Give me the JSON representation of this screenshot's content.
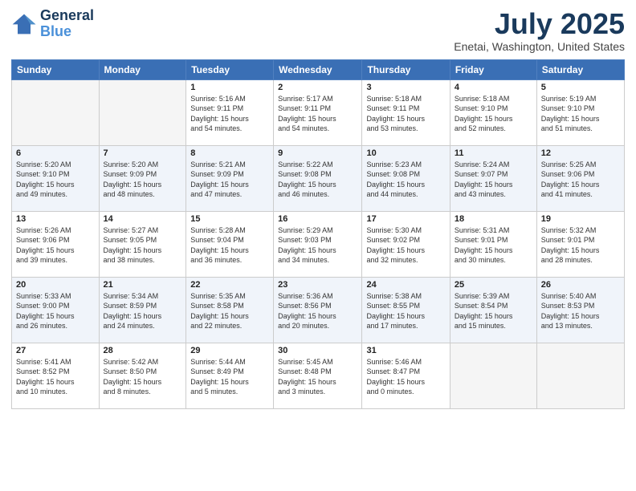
{
  "header": {
    "logo_line1": "General",
    "logo_line2": "Blue",
    "month": "July 2025",
    "location": "Enetai, Washington, United States"
  },
  "weekdays": [
    "Sunday",
    "Monday",
    "Tuesday",
    "Wednesday",
    "Thursday",
    "Friday",
    "Saturday"
  ],
  "weeks": [
    [
      {
        "day": "",
        "info": ""
      },
      {
        "day": "",
        "info": ""
      },
      {
        "day": "1",
        "info": "Sunrise: 5:16 AM\nSunset: 9:11 PM\nDaylight: 15 hours\nand 54 minutes."
      },
      {
        "day": "2",
        "info": "Sunrise: 5:17 AM\nSunset: 9:11 PM\nDaylight: 15 hours\nand 54 minutes."
      },
      {
        "day": "3",
        "info": "Sunrise: 5:18 AM\nSunset: 9:11 PM\nDaylight: 15 hours\nand 53 minutes."
      },
      {
        "day": "4",
        "info": "Sunrise: 5:18 AM\nSunset: 9:10 PM\nDaylight: 15 hours\nand 52 minutes."
      },
      {
        "day": "5",
        "info": "Sunrise: 5:19 AM\nSunset: 9:10 PM\nDaylight: 15 hours\nand 51 minutes."
      }
    ],
    [
      {
        "day": "6",
        "info": "Sunrise: 5:20 AM\nSunset: 9:10 PM\nDaylight: 15 hours\nand 49 minutes."
      },
      {
        "day": "7",
        "info": "Sunrise: 5:20 AM\nSunset: 9:09 PM\nDaylight: 15 hours\nand 48 minutes."
      },
      {
        "day": "8",
        "info": "Sunrise: 5:21 AM\nSunset: 9:09 PM\nDaylight: 15 hours\nand 47 minutes."
      },
      {
        "day": "9",
        "info": "Sunrise: 5:22 AM\nSunset: 9:08 PM\nDaylight: 15 hours\nand 46 minutes."
      },
      {
        "day": "10",
        "info": "Sunrise: 5:23 AM\nSunset: 9:08 PM\nDaylight: 15 hours\nand 44 minutes."
      },
      {
        "day": "11",
        "info": "Sunrise: 5:24 AM\nSunset: 9:07 PM\nDaylight: 15 hours\nand 43 minutes."
      },
      {
        "day": "12",
        "info": "Sunrise: 5:25 AM\nSunset: 9:06 PM\nDaylight: 15 hours\nand 41 minutes."
      }
    ],
    [
      {
        "day": "13",
        "info": "Sunrise: 5:26 AM\nSunset: 9:06 PM\nDaylight: 15 hours\nand 39 minutes."
      },
      {
        "day": "14",
        "info": "Sunrise: 5:27 AM\nSunset: 9:05 PM\nDaylight: 15 hours\nand 38 minutes."
      },
      {
        "day": "15",
        "info": "Sunrise: 5:28 AM\nSunset: 9:04 PM\nDaylight: 15 hours\nand 36 minutes."
      },
      {
        "day": "16",
        "info": "Sunrise: 5:29 AM\nSunset: 9:03 PM\nDaylight: 15 hours\nand 34 minutes."
      },
      {
        "day": "17",
        "info": "Sunrise: 5:30 AM\nSunset: 9:02 PM\nDaylight: 15 hours\nand 32 minutes."
      },
      {
        "day": "18",
        "info": "Sunrise: 5:31 AM\nSunset: 9:01 PM\nDaylight: 15 hours\nand 30 minutes."
      },
      {
        "day": "19",
        "info": "Sunrise: 5:32 AM\nSunset: 9:01 PM\nDaylight: 15 hours\nand 28 minutes."
      }
    ],
    [
      {
        "day": "20",
        "info": "Sunrise: 5:33 AM\nSunset: 9:00 PM\nDaylight: 15 hours\nand 26 minutes."
      },
      {
        "day": "21",
        "info": "Sunrise: 5:34 AM\nSunset: 8:59 PM\nDaylight: 15 hours\nand 24 minutes."
      },
      {
        "day": "22",
        "info": "Sunrise: 5:35 AM\nSunset: 8:58 PM\nDaylight: 15 hours\nand 22 minutes."
      },
      {
        "day": "23",
        "info": "Sunrise: 5:36 AM\nSunset: 8:56 PM\nDaylight: 15 hours\nand 20 minutes."
      },
      {
        "day": "24",
        "info": "Sunrise: 5:38 AM\nSunset: 8:55 PM\nDaylight: 15 hours\nand 17 minutes."
      },
      {
        "day": "25",
        "info": "Sunrise: 5:39 AM\nSunset: 8:54 PM\nDaylight: 15 hours\nand 15 minutes."
      },
      {
        "day": "26",
        "info": "Sunrise: 5:40 AM\nSunset: 8:53 PM\nDaylight: 15 hours\nand 13 minutes."
      }
    ],
    [
      {
        "day": "27",
        "info": "Sunrise: 5:41 AM\nSunset: 8:52 PM\nDaylight: 15 hours\nand 10 minutes."
      },
      {
        "day": "28",
        "info": "Sunrise: 5:42 AM\nSunset: 8:50 PM\nDaylight: 15 hours\nand 8 minutes."
      },
      {
        "day": "29",
        "info": "Sunrise: 5:44 AM\nSunset: 8:49 PM\nDaylight: 15 hours\nand 5 minutes."
      },
      {
        "day": "30",
        "info": "Sunrise: 5:45 AM\nSunset: 8:48 PM\nDaylight: 15 hours\nand 3 minutes."
      },
      {
        "day": "31",
        "info": "Sunrise: 5:46 AM\nSunset: 8:47 PM\nDaylight: 15 hours\nand 0 minutes."
      },
      {
        "day": "",
        "info": ""
      },
      {
        "day": "",
        "info": ""
      }
    ]
  ]
}
